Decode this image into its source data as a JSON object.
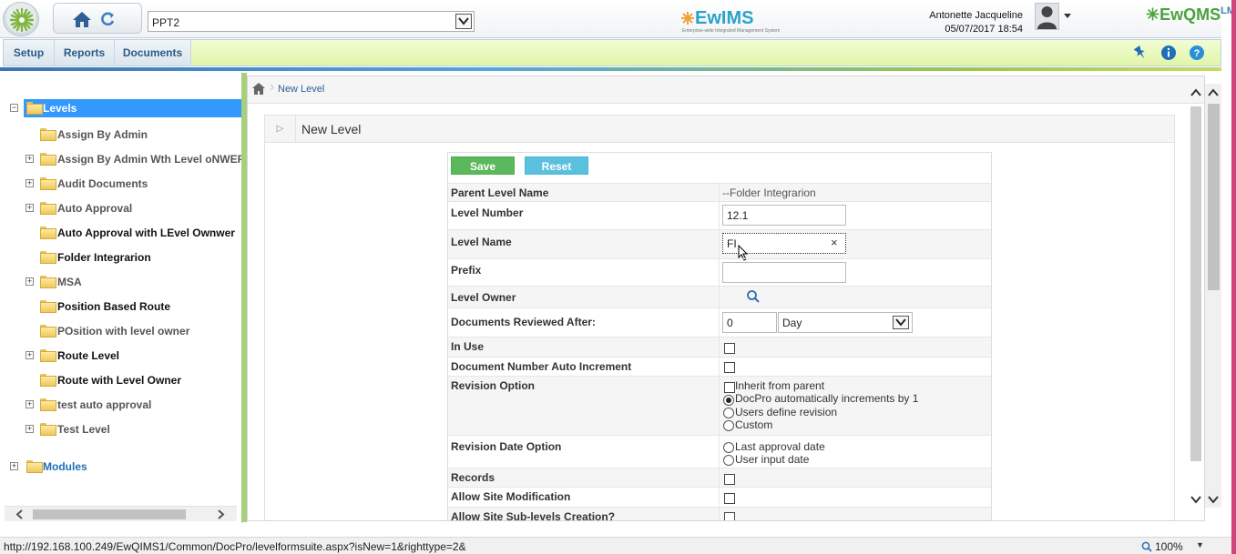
{
  "topbar": {
    "site_value": "PPT2",
    "brand_center": "EwIMS",
    "brand_center_tagline": "Enterprise-wide Integrated Management System",
    "user_name": "Antonette Jacqueline",
    "datetime": "05/07/2017 18:54",
    "brand_right": "EwQMS",
    "brand_right_sup": "LMS"
  },
  "menu": {
    "items": [
      "Setup",
      "Reports",
      "Documents"
    ]
  },
  "tree": {
    "root": "Levels",
    "items": [
      "Assign By Admin",
      "Assign By Admin Wth Level oNWER",
      "Audit Documents",
      "Auto Approval",
      "Auto Approval with LEvel Ownwer",
      "Folder Integrarion",
      "MSA",
      "Position Based Route",
      "POsition with level owner",
      "Route Level",
      "Route with Level Owner",
      "test auto approval",
      "Test Level"
    ],
    "modules": "Modules"
  },
  "breadcrumb": {
    "current": "New Level"
  },
  "panel": {
    "title": "New Level"
  },
  "form": {
    "save_label": "Save",
    "reset_label": "Reset",
    "parent_level_label": "Parent Level Name",
    "parent_level_value": "--Folder Integrarion",
    "level_number_label": "Level Number",
    "level_number_value": "12.1",
    "level_name_label": "Level Name",
    "level_name_value": "FI",
    "prefix_label": "Prefix",
    "prefix_value": "",
    "level_owner_label": "Level Owner",
    "docs_reviewed_label": "Documents Reviewed After:",
    "docs_reviewed_value": "0",
    "docs_reviewed_unit": "Day",
    "in_use_label": "In Use",
    "auto_increment_label": "Document Number Auto Increment",
    "revision_option_label": "Revision Option",
    "revision_options": [
      "Inherit from parent",
      "DocPro automatically increments by 1",
      "Users define revision",
      "Custom"
    ],
    "revision_selected": "DocPro automatically increments by 1",
    "revision_date_label": "Revision Date Option",
    "revision_date_options": [
      "Last approval date",
      "User input date"
    ],
    "records_label": "Records",
    "site_mod_label": "Allow Site Modification",
    "site_sublevels_label": "Allow Site Sub-levels Creation?"
  },
  "statusbar": {
    "url": "http://192.168.100.249/EwQIMS1/Common/DocPro/levelformsuite.aspx?isNew=1&righttype=2&",
    "zoom": "100%"
  },
  "colors": {
    "accent": "#3399ff",
    "save": "#5cb85c",
    "reset": "#5bc0de",
    "menubar": "#e1f5ab"
  }
}
